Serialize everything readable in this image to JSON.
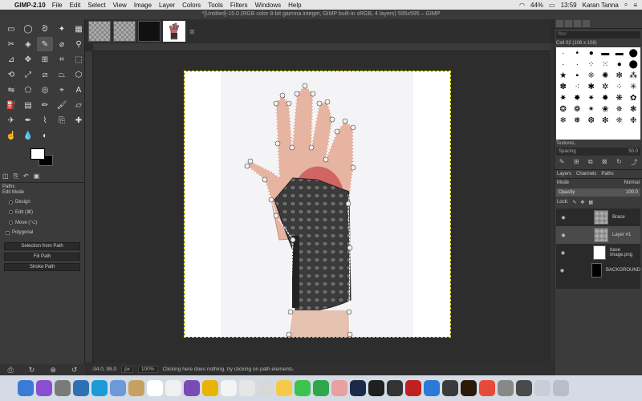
{
  "menubar": {
    "app": "GIMP-2.10",
    "items": [
      "File",
      "Edit",
      "Select",
      "View",
      "Image",
      "Layer",
      "Colors",
      "Tools",
      "Filters",
      "Windows",
      "Help"
    ],
    "battery": "44%",
    "time": "13:59",
    "user": "Karan Tanna"
  },
  "window": {
    "title": "*[Untitled]-15.0 (RGB color 8-bit gamma integer, GIMP built-in sRGB, 4 layers) 595x595 – GIMP"
  },
  "tool_options": {
    "title": "Paths",
    "edit_mode_label": "Edit Mode",
    "modes": [
      "Design",
      "Edit (⌘)",
      "Move (⌥)"
    ],
    "polygonal": "Polygonal",
    "buttons": [
      "Selection from Path",
      "Fill Path",
      "Stroke Path"
    ]
  },
  "status": {
    "coords": "-34.0, 98.0",
    "unit": "px",
    "zoom": "100%",
    "message": "Clicking here does nothing, try clicking on path elements."
  },
  "brushes": {
    "filter_placeholder": "filter",
    "current": "Cell 02 (106 x 108)",
    "tag": "Textures,",
    "spacing_label": "Spacing",
    "spacing_value": "50.0"
  },
  "layers_panel": {
    "tabs": [
      "Layers",
      "Channels",
      "Paths"
    ],
    "mode_label": "Mode",
    "mode_value": "Normal",
    "opacity_label": "Opacity",
    "opacity_value": "100.0",
    "lock_label": "Lock:",
    "layers": [
      {
        "name": "Brace",
        "thumb": "checker"
      },
      {
        "name": "Layer #1",
        "thumb": "checker"
      },
      {
        "name": "base image.png",
        "thumb": "photo"
      },
      {
        "name": "BACKGROUND",
        "thumb": "black"
      }
    ]
  },
  "colors": {
    "fg": "#ffffff",
    "bg": "#000000",
    "path_stroke": "#ffffff"
  }
}
